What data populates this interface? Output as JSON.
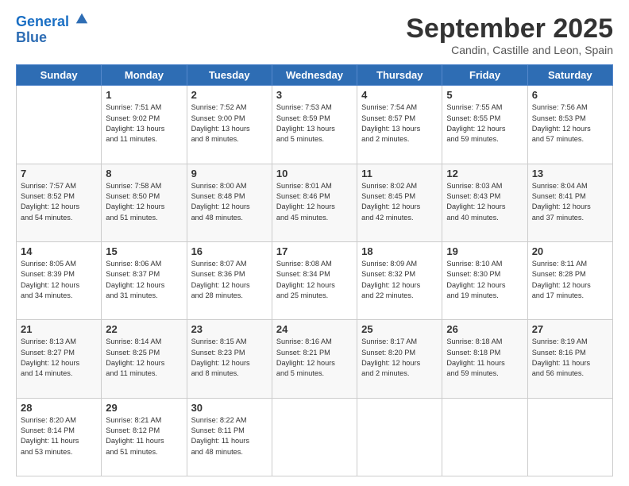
{
  "header": {
    "logo_line1": "General",
    "logo_line2": "Blue",
    "month_title": "September 2025",
    "location": "Candin, Castille and Leon, Spain"
  },
  "days_of_week": [
    "Sunday",
    "Monday",
    "Tuesday",
    "Wednesday",
    "Thursday",
    "Friday",
    "Saturday"
  ],
  "weeks": [
    [
      {
        "day": "",
        "info": ""
      },
      {
        "day": "1",
        "info": "Sunrise: 7:51 AM\nSunset: 9:02 PM\nDaylight: 13 hours\nand 11 minutes."
      },
      {
        "day": "2",
        "info": "Sunrise: 7:52 AM\nSunset: 9:00 PM\nDaylight: 13 hours\nand 8 minutes."
      },
      {
        "day": "3",
        "info": "Sunrise: 7:53 AM\nSunset: 8:59 PM\nDaylight: 13 hours\nand 5 minutes."
      },
      {
        "day": "4",
        "info": "Sunrise: 7:54 AM\nSunset: 8:57 PM\nDaylight: 13 hours\nand 2 minutes."
      },
      {
        "day": "5",
        "info": "Sunrise: 7:55 AM\nSunset: 8:55 PM\nDaylight: 12 hours\nand 59 minutes."
      },
      {
        "day": "6",
        "info": "Sunrise: 7:56 AM\nSunset: 8:53 PM\nDaylight: 12 hours\nand 57 minutes."
      }
    ],
    [
      {
        "day": "7",
        "info": "Sunrise: 7:57 AM\nSunset: 8:52 PM\nDaylight: 12 hours\nand 54 minutes."
      },
      {
        "day": "8",
        "info": "Sunrise: 7:58 AM\nSunset: 8:50 PM\nDaylight: 12 hours\nand 51 minutes."
      },
      {
        "day": "9",
        "info": "Sunrise: 8:00 AM\nSunset: 8:48 PM\nDaylight: 12 hours\nand 48 minutes."
      },
      {
        "day": "10",
        "info": "Sunrise: 8:01 AM\nSunset: 8:46 PM\nDaylight: 12 hours\nand 45 minutes."
      },
      {
        "day": "11",
        "info": "Sunrise: 8:02 AM\nSunset: 8:45 PM\nDaylight: 12 hours\nand 42 minutes."
      },
      {
        "day": "12",
        "info": "Sunrise: 8:03 AM\nSunset: 8:43 PM\nDaylight: 12 hours\nand 40 minutes."
      },
      {
        "day": "13",
        "info": "Sunrise: 8:04 AM\nSunset: 8:41 PM\nDaylight: 12 hours\nand 37 minutes."
      }
    ],
    [
      {
        "day": "14",
        "info": "Sunrise: 8:05 AM\nSunset: 8:39 PM\nDaylight: 12 hours\nand 34 minutes."
      },
      {
        "day": "15",
        "info": "Sunrise: 8:06 AM\nSunset: 8:37 PM\nDaylight: 12 hours\nand 31 minutes."
      },
      {
        "day": "16",
        "info": "Sunrise: 8:07 AM\nSunset: 8:36 PM\nDaylight: 12 hours\nand 28 minutes."
      },
      {
        "day": "17",
        "info": "Sunrise: 8:08 AM\nSunset: 8:34 PM\nDaylight: 12 hours\nand 25 minutes."
      },
      {
        "day": "18",
        "info": "Sunrise: 8:09 AM\nSunset: 8:32 PM\nDaylight: 12 hours\nand 22 minutes."
      },
      {
        "day": "19",
        "info": "Sunrise: 8:10 AM\nSunset: 8:30 PM\nDaylight: 12 hours\nand 19 minutes."
      },
      {
        "day": "20",
        "info": "Sunrise: 8:11 AM\nSunset: 8:28 PM\nDaylight: 12 hours\nand 17 minutes."
      }
    ],
    [
      {
        "day": "21",
        "info": "Sunrise: 8:13 AM\nSunset: 8:27 PM\nDaylight: 12 hours\nand 14 minutes."
      },
      {
        "day": "22",
        "info": "Sunrise: 8:14 AM\nSunset: 8:25 PM\nDaylight: 12 hours\nand 11 minutes."
      },
      {
        "day": "23",
        "info": "Sunrise: 8:15 AM\nSunset: 8:23 PM\nDaylight: 12 hours\nand 8 minutes."
      },
      {
        "day": "24",
        "info": "Sunrise: 8:16 AM\nSunset: 8:21 PM\nDaylight: 12 hours\nand 5 minutes."
      },
      {
        "day": "25",
        "info": "Sunrise: 8:17 AM\nSunset: 8:20 PM\nDaylight: 12 hours\nand 2 minutes."
      },
      {
        "day": "26",
        "info": "Sunrise: 8:18 AM\nSunset: 8:18 PM\nDaylight: 11 hours\nand 59 minutes."
      },
      {
        "day": "27",
        "info": "Sunrise: 8:19 AM\nSunset: 8:16 PM\nDaylight: 11 hours\nand 56 minutes."
      }
    ],
    [
      {
        "day": "28",
        "info": "Sunrise: 8:20 AM\nSunset: 8:14 PM\nDaylight: 11 hours\nand 53 minutes."
      },
      {
        "day": "29",
        "info": "Sunrise: 8:21 AM\nSunset: 8:12 PM\nDaylight: 11 hours\nand 51 minutes."
      },
      {
        "day": "30",
        "info": "Sunrise: 8:22 AM\nSunset: 8:11 PM\nDaylight: 11 hours\nand 48 minutes."
      },
      {
        "day": "",
        "info": ""
      },
      {
        "day": "",
        "info": ""
      },
      {
        "day": "",
        "info": ""
      },
      {
        "day": "",
        "info": ""
      }
    ]
  ]
}
